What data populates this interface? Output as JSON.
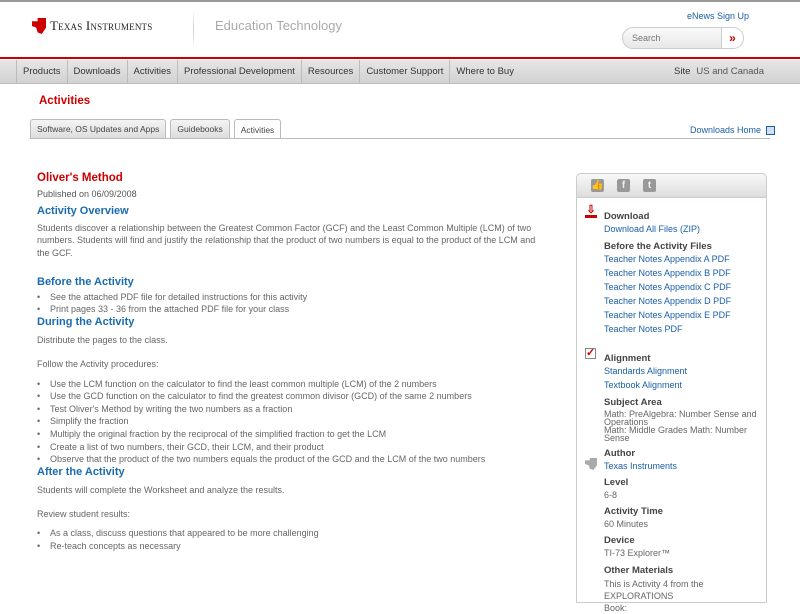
{
  "header": {
    "brand": "Texas Instruments",
    "section": "Education Technology",
    "enews": "eNews Sign Up",
    "search_placeholder": "Search",
    "search_button": "»"
  },
  "nav": {
    "items": [
      "Products",
      "Downloads",
      "Activities",
      "Professional Development",
      "Resources",
      "Customer Support",
      "Where to Buy"
    ],
    "site_label": "Site",
    "site_value": "US and Canada"
  },
  "page_title": "Activities",
  "tabs": [
    "Software, OS Updates and Apps",
    "Guidebooks",
    "Activities"
  ],
  "downloads_home": "Downloads Home",
  "main": {
    "title": "Oliver's Method",
    "published": "Published on 06/09/2008",
    "overview_heading": "Activity Overview",
    "overview": "Students discover a relationship between the Greatest Common Factor (GCF) and the Least Common Multiple (LCM) of two numbers. Students will find and justify the relationship that the product of two numbers is equal to the product of the LCM and the GCF.",
    "before_heading": "Before the Activity",
    "before_items": [
      "See the attached PDF file for detailed instructions for this activity",
      "Print pages 33 - 36 from the attached PDF file for your class"
    ],
    "during_heading": "During the Activity",
    "during_p1": "Distribute the pages to the class.",
    "during_p2": "Follow the Activity procedures:",
    "during_items": [
      "Use the LCM function on the calculator to find the least common multiple (LCM) of the 2 numbers",
      "Use the GCD function on the calculator to find the greatest common divisor (GCD) of the same 2 numbers",
      "Test Oliver's Method by writing the two numbers as a fraction",
      "Simplify the fraction",
      "Multiply the original fraction by the reciprocal of the simplified fraction to get the LCM",
      "Create a list of two numbers, their GCD, their LCM, and their product",
      "Observe that the product of the two numbers equals the product of the GCD and the LCM of the two numbers"
    ],
    "after_heading": "After the Activity",
    "after_p1": "Students will complete the Worksheet and analyze the results.",
    "after_p2": "Review student results:",
    "after_items": [
      "As a class, discuss questions that appeared to be more challenging",
      "Re-teach concepts as necessary"
    ]
  },
  "sidebar": {
    "download_heading": "Download",
    "download_all": "Download All Files (ZIP)",
    "before_files_heading": "Before the Activity Files",
    "files": [
      "Teacher Notes Appendix A PDF",
      "Teacher Notes Appendix B PDF",
      "Teacher Notes Appendix C PDF",
      "Teacher Notes Appendix D PDF",
      "Teacher Notes Appendix E PDF",
      "Teacher Notes PDF"
    ],
    "alignment_heading": "Alignment",
    "alignment_links": [
      "Standards Alignment",
      "Textbook Alignment"
    ],
    "subject_heading": "Subject Area",
    "subjects": [
      "Math: PreAlgebra: Number Sense and",
      "Operations",
      "Math: Middle Grades Math: Number Sense"
    ],
    "author_heading": "Author",
    "author": "Texas Instruments",
    "level_heading": "Level",
    "level": "6-8",
    "time_heading": "Activity Time",
    "time": "60 Minutes",
    "device_heading": "Device",
    "device": "TI-73 Explorer™",
    "materials_heading": "Other Materials",
    "materials": [
      "This is Activity 4 from the EXPLORATIONS",
      "Book:"
    ]
  }
}
